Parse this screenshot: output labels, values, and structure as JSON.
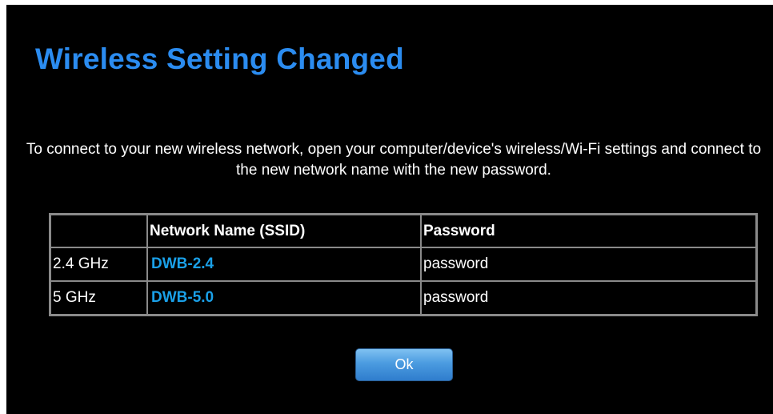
{
  "dialog": {
    "title": "Wireless Setting Changed",
    "instructions": "To connect to your new wireless network, open your computer/device's wireless/Wi-Fi settings and connect to the new network name with the new password."
  },
  "table": {
    "headers": [
      "",
      "Network Name (SSID)",
      "Password"
    ],
    "rows": [
      {
        "band": "2.4 GHz",
        "ssid": "DWB-2.4",
        "password": "password"
      },
      {
        "band": "5 GHz",
        "ssid": "DWB-5.0",
        "password": "password"
      }
    ]
  },
  "actions": {
    "ok_label": "Ok"
  },
  "colors": {
    "background": "#000000",
    "title": "#2b8cf0",
    "ssid": "#1aa0e8",
    "button": "#4b9be0"
  }
}
